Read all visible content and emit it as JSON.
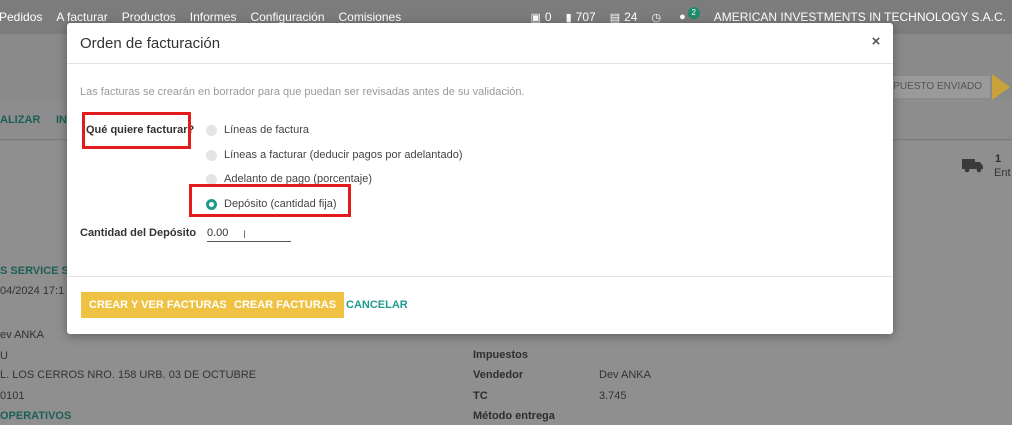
{
  "topbar": {
    "menu": [
      "Pedidos",
      "A facturar",
      "Productos",
      "Informes",
      "Configuración",
      "Comisiones"
    ],
    "indicators": [
      {
        "icon": "gift-icon",
        "glyph": "▣",
        "value": "0"
      },
      {
        "icon": "truck-icon",
        "glyph": "▮",
        "value": "707"
      },
      {
        "icon": "money-icon",
        "glyph": "▤",
        "value": "24"
      },
      {
        "icon": "clock-icon",
        "glyph": "◷",
        "value": ""
      },
      {
        "icon": "chat-icon",
        "glyph": "●",
        "value": "2"
      }
    ],
    "company": "AMERICAN INVESTMENTS IN TECHNOLOGY S.A.C."
  },
  "background": {
    "toolbar_left": "ALIZAR",
    "toolbar_left2": "IN",
    "status": "SUPUESTO ENVIADO",
    "stat_count": "1",
    "stat_label": "Ent",
    "customer": "S SERVICE S.",
    "date": "04/2024 17:1",
    "person": "ev ANKA",
    "city": "U",
    "address": "L. LOS CERROS NRO. 158 URB. 03 DE OCTUBRE",
    "zip": "0101",
    "team": "OPERATIVOS",
    "fields": [
      {
        "label": "Impuestos",
        "value": ""
      },
      {
        "label": "Vendedor",
        "value": "Dev ANKA"
      },
      {
        "label": "TC",
        "value": "3.745"
      },
      {
        "label": "Método entrega",
        "value": ""
      }
    ]
  },
  "modal": {
    "title": "Orden de facturación",
    "close": "×",
    "info": "Las facturas se crearán en borrador para que puedan ser revisadas antes de su validación.",
    "question_label": "Qué quiere facturar?",
    "options": [
      {
        "label": "Líneas de factura",
        "selected": false
      },
      {
        "label": "Líneas a facturar (deducir pagos por adelantado)",
        "selected": false
      },
      {
        "label": "Adelanto de pago (porcentaje)",
        "selected": false
      },
      {
        "label": "Depósito (cantidad fija)",
        "selected": true
      }
    ],
    "amount_label": "Cantidad del Depósito",
    "amount_value": "0.00",
    "buttons": {
      "create_view": "CREAR Y VER FACTURAS",
      "create": "CREAR FACTURAS",
      "cancel": "CANCELAR"
    }
  },
  "colors": {
    "accent": "#f0c243",
    "teal": "#1f9b8c",
    "highlight": "#e21c1c"
  }
}
